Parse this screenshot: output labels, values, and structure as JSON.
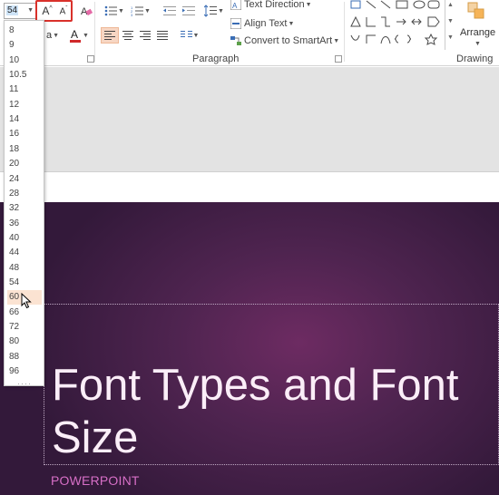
{
  "font_size_box": {
    "value": "54"
  },
  "font_size_list": [
    "8",
    "9",
    "10",
    "10.5",
    "11",
    "12",
    "14",
    "16",
    "18",
    "20",
    "24",
    "28",
    "32",
    "36",
    "40",
    "44",
    "48",
    "54",
    "60",
    "66",
    "72",
    "80",
    "88",
    "96"
  ],
  "hovered_size": "60",
  "paragraph": {
    "text_direction_label": "Text Direction",
    "align_text_label": "Align Text",
    "convert_smartart_label": "Convert to SmartArt",
    "group_label": "Paragraph"
  },
  "drawing": {
    "arrange_label": "Arrange",
    "group_label": "Drawing"
  },
  "slide": {
    "title": "Font Types and Font Size",
    "subtitle": "POWERPOINT"
  },
  "colors": {
    "highlight_box": "#d9312b",
    "slide_bg": "#4f2450",
    "subtitle": "#d76fc7",
    "hover": "#fbe3d2"
  }
}
